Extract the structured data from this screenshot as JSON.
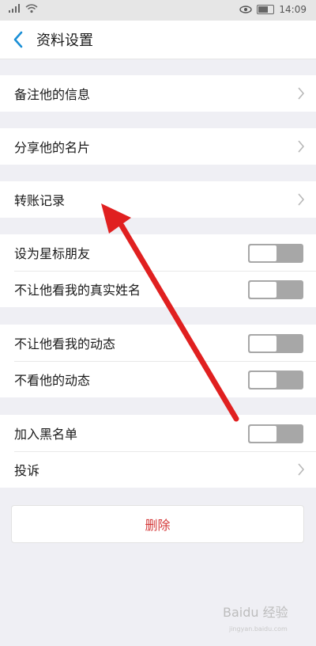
{
  "status_bar": {
    "time": "14:09",
    "icons": [
      "signal-icon",
      "wifi-icon",
      "eye-icon",
      "battery-icon"
    ]
  },
  "header": {
    "back_icon": "chevron-left-icon",
    "title": "资料设置"
  },
  "groups": [
    {
      "rows": [
        {
          "label": "备注他的信息",
          "control": "chevron"
        }
      ]
    },
    {
      "rows": [
        {
          "label": "分享他的名片",
          "control": "chevron"
        }
      ]
    },
    {
      "rows": [
        {
          "label": "转账记录",
          "control": "chevron"
        }
      ]
    },
    {
      "rows": [
        {
          "label": "设为星标朋友",
          "control": "toggle",
          "on": false
        },
        {
          "label": "不让他看我的真实姓名",
          "control": "toggle",
          "on": false
        }
      ]
    },
    {
      "rows": [
        {
          "label": "不让他看我的动态",
          "control": "toggle",
          "on": false
        },
        {
          "label": "不看他的动态",
          "control": "toggle",
          "on": false
        }
      ]
    },
    {
      "rows": [
        {
          "label": "加入黑名单",
          "control": "toggle",
          "on": false
        },
        {
          "label": "投诉",
          "control": "chevron"
        }
      ]
    }
  ],
  "delete_button": {
    "label": "删除"
  },
  "colors": {
    "accent": "#1a8fd6",
    "delete_text": "#d43b3b",
    "toggle_track": "#a7a7a7",
    "annotation_arrow": "#e02020"
  },
  "watermark": {
    "text": "Baidu 经验",
    "subtext": "jingyan.baidu.com"
  }
}
